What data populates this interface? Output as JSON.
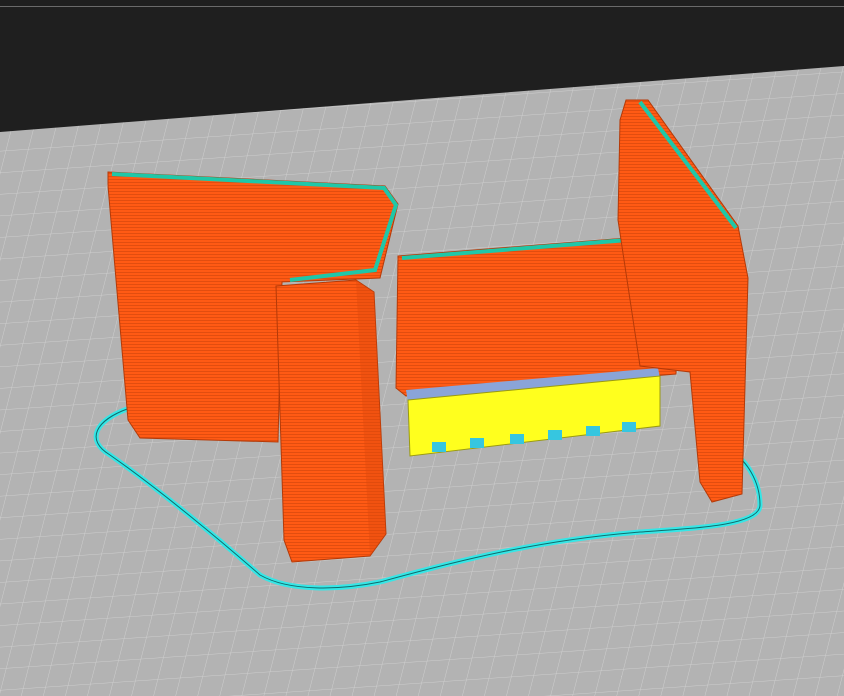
{
  "scene": {
    "background_color": "#1f1f1f",
    "bed_color": "#b3b3b3",
    "grid_color": "#cfcfcf",
    "model_color": "#ff5a14",
    "model_shade_color": "#e04a0c",
    "top_edge_color": "#1fc7a8",
    "support_color": "#ffff1e",
    "support_interface_color": "#8aa4d8",
    "skirt_color": "#36e6e6"
  }
}
